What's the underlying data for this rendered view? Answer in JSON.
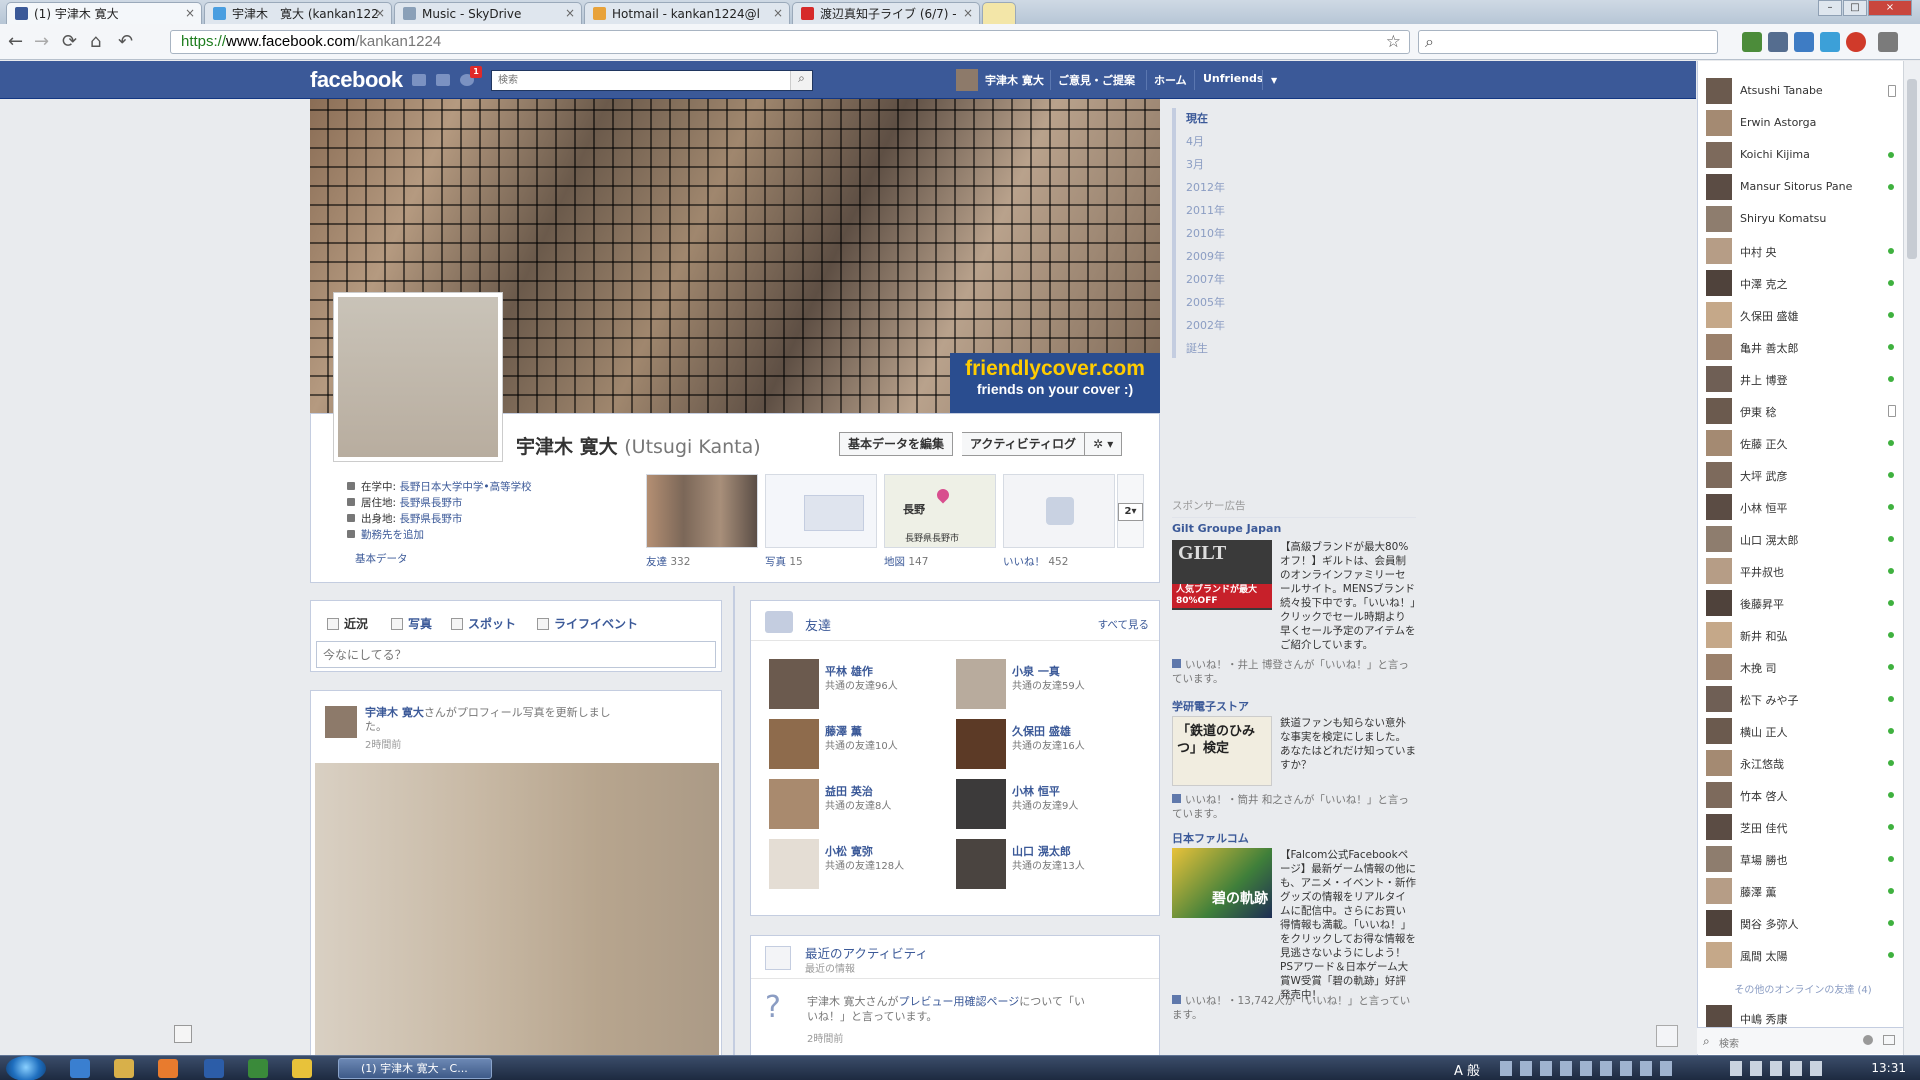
{
  "browser": {
    "tabs": [
      {
        "title": "(1) 宇津木 寛大",
        "favicon_color": "#3b5998",
        "active": true
      },
      {
        "title": "宇津木　寛大 (kankan122",
        "favicon_color": "#4a9ee0",
        "active": false
      },
      {
        "title": "Music - SkyDrive",
        "favicon_color": "#8aa0b8",
        "active": false
      },
      {
        "title": "Hotmail - kankan1224@l",
        "favicon_color": "#e8a23a",
        "active": false
      },
      {
        "title": "渡辺真知子ライブ (6/7) -",
        "favicon_color": "#d62a2a",
        "active": false
      }
    ],
    "close_glyph": "×",
    "window_controls": [
      "–",
      "□",
      "×"
    ],
    "nav": {
      "back": "←",
      "forward": "→",
      "reload": "⟳",
      "home": "⌂",
      "history": "↶"
    },
    "url_https": "https://",
    "url_host": "www.facebook.com",
    "url_path": "/kankan1224",
    "star": "☆",
    "search_glyph": "⌕"
  },
  "facebook": {
    "logo": "facebook",
    "search_placeholder": "検索",
    "notification_count": "1",
    "user_name": "宇津木 寛大",
    "nav_feedback": "ご意見・ご提案",
    "nav_home": "ホーム",
    "nav_unfriends": "Unfriends",
    "dropdown": "▼"
  },
  "cover": {
    "ad_line1": "friendlycover.com",
    "ad_line2": "friends on your cover :)"
  },
  "profile": {
    "name": "宇津木 寛大",
    "romaji": "(Utsugi Kanta)",
    "btn_edit": "基本データを編集",
    "btn_activity": "アクティビティログ",
    "btn_gear": "✲ ▾",
    "info": [
      {
        "label": "在学中:",
        "value": "長野日本大学中学•高等学校"
      },
      {
        "label": "居住地:",
        "value": "長野県長野市"
      },
      {
        "label": "出身地:",
        "value": "長野県長野市"
      },
      {
        "label": "",
        "value": "勤務先を追加"
      }
    ],
    "basic_data_link": "基本データ",
    "tiles": [
      {
        "label": "友達",
        "count": "332"
      },
      {
        "label": "写真",
        "count": "15"
      },
      {
        "label": "地図",
        "count": "147"
      },
      {
        "label": "いいね！",
        "count": "452"
      }
    ],
    "map_city": "長野",
    "map_caption": "長野県長野市",
    "tiles_more": "2▾"
  },
  "composer": {
    "tabs": [
      "近況",
      "写真",
      "スポット",
      "ライフイベント"
    ],
    "placeholder": "今なにしてる？"
  },
  "story": {
    "author": "宇津木 寛大",
    "text_mid": "さんがプロフィール写真を更新しまし",
    "text_end": "た。",
    "time": "2時間前"
  },
  "friends_box": {
    "title": "友達",
    "see_all": "すべて見る",
    "items": [
      {
        "name": "平林 雄作",
        "mutual": "共通の友達96人"
      },
      {
        "name": "小泉 一真",
        "mutual": "共通の友達59人"
      },
      {
        "name": "藤澤 薫",
        "mutual": "共通の友達10人"
      },
      {
        "name": "久保田 盛雄",
        "mutual": "共通の友達16人"
      },
      {
        "name": "益田 英治",
        "mutual": "共通の友達8人"
      },
      {
        "name": "小林 恒平",
        "mutual": "共通の友達9人"
      },
      {
        "name": "小松 寛弥",
        "mutual": "共通の友達128人"
      },
      {
        "name": "山口 滉太郎",
        "mutual": "共通の友達13人"
      }
    ]
  },
  "activity": {
    "title": "最近のアクティビティ",
    "subtitle": "最近の情報",
    "text_author": "宇津木 寛大",
    "text_mid": "さんが",
    "text_link": "プレビュー用確認ページ",
    "text_end": "について「い",
    "text_end2": "いね！」と言っています。",
    "time": "2時間前"
  },
  "timeline": [
    "現在",
    "4月",
    "3月",
    "2012年",
    "2011年",
    "2010年",
    "2009年",
    "2007年",
    "2005年",
    "2002年",
    "誕生"
  ],
  "ads": {
    "header": "スポンサー広告",
    "items": [
      {
        "title": "Gilt Groupe Japan",
        "img_text": "GILT",
        "img_sub": "人気ブランドが最大80%OFF",
        "text": "【高級ブランドが最大80%オフ！】ギルトは、会員制のオンラインファミリーセールサイト。MENSブランド続々投下中です。「いいね！」クリックでセール時期より早くセール予定のアイテムをご紹介しています。",
        "like": "いいね！・井上 博登さんが「いいね！」と言っています。"
      },
      {
        "title": "学研電子ストア",
        "img_text": "「鉄道のひみつ」検定",
        "img_sub": "",
        "text": "鉄道ファンも知らない意外な事実を検定にしました。あなたはどれだけ知っていますか？",
        "like": "いいね！・筒井 和之さんが「いいね！」と言っています。"
      },
      {
        "title": "日本ファルコム",
        "img_text": "碧の軌跡",
        "img_sub": "",
        "text": "【Falcom公式Facebookページ】最新ゲーム情報の他にも、アニメ・イベント・新作グッズの情報をリアルタイムに配信中。さらにお買い得情報も満載。「いいね！」をクリックしてお得な情報を見逃さないようにしよう！PSアワード＆日本ゲーム大賞W受賞「碧の軌跡」好評発売中！",
        "like": "いいね！・13,742人が「いいね！」と言っています。"
      }
    ]
  },
  "chat": {
    "friends": [
      {
        "name": "Atsushi Tanabe",
        "status": "mobile"
      },
      {
        "name": "Erwin Astorga",
        "status": "none"
      },
      {
        "name": "Koichi Kijima",
        "status": "online"
      },
      {
        "name": "Mansur Sitorus Pane",
        "status": "online"
      },
      {
        "name": "Shiryu Komatsu",
        "status": "none"
      },
      {
        "name": "中村 央",
        "status": "online"
      },
      {
        "name": "中澤 克之",
        "status": "online"
      },
      {
        "name": "久保田 盛雄",
        "status": "online"
      },
      {
        "name": "亀井 善太郎",
        "status": "online"
      },
      {
        "name": "井上 博登",
        "status": "online"
      },
      {
        "name": "伊東 稔",
        "status": "mobile"
      },
      {
        "name": "佐藤 正久",
        "status": "online"
      },
      {
        "name": "大坪 武彦",
        "status": "online"
      },
      {
        "name": "小林 恒平",
        "status": "online"
      },
      {
        "name": "山口 滉太郎",
        "status": "online"
      },
      {
        "name": "平井叔也",
        "status": "online"
      },
      {
        "name": "後藤昇平",
        "status": "online"
      },
      {
        "name": "新井 和弘",
        "status": "online"
      },
      {
        "name": "木挽 司",
        "status": "online"
      },
      {
        "name": "松下 みや子",
        "status": "online"
      },
      {
        "name": "横山 正人",
        "status": "online"
      },
      {
        "name": "永江悠哉",
        "status": "online"
      },
      {
        "name": "竹本 啓人",
        "status": "online"
      },
      {
        "name": "芝田 佳代",
        "status": "online"
      },
      {
        "name": "草場 勝也",
        "status": "online"
      },
      {
        "name": "藤澤 薫",
        "status": "online"
      },
      {
        "name": "関谷 多弥人",
        "status": "online"
      },
      {
        "name": "風間 太陽",
        "status": "online"
      }
    ],
    "others_header": "その他のオンラインの友達 (4)",
    "partial_name": "中嶋 秀康",
    "search_placeholder": "検索"
  },
  "taskbar": {
    "task_label": "(1) 宇津木 寛大 - C...",
    "tray": "A 般",
    "clock": "13:31"
  }
}
